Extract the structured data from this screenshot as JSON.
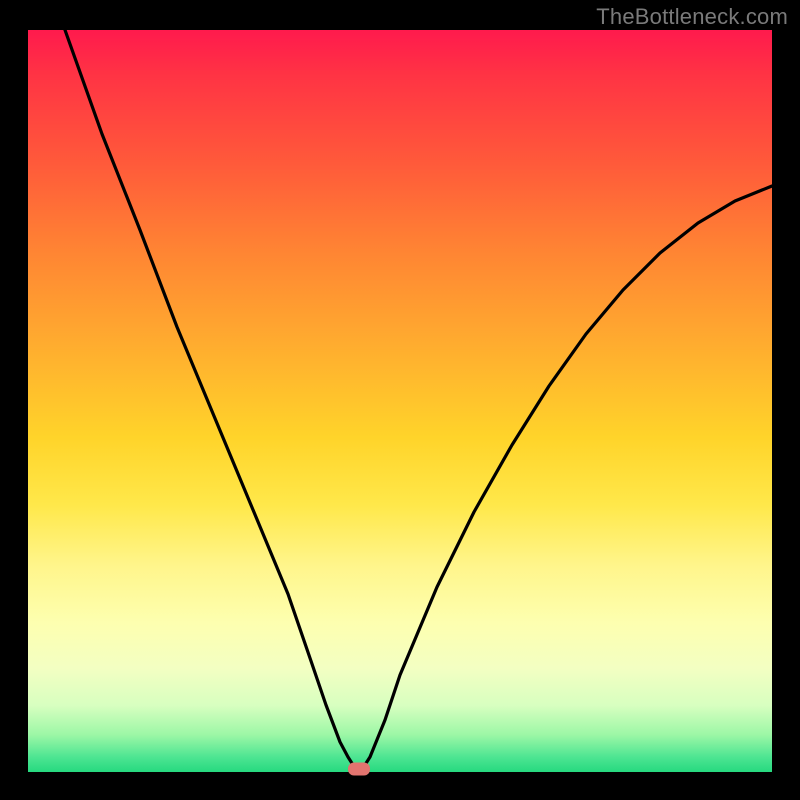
{
  "watermark": "TheBottleneck.com",
  "chart_data": {
    "type": "line",
    "title": "",
    "xlabel": "",
    "ylabel": "",
    "xlim": [
      0,
      100
    ],
    "ylim": [
      0,
      100
    ],
    "grid": false,
    "series": [
      {
        "name": "bottleneck-curve",
        "x": [
          5,
          10,
          15,
          20,
          25,
          30,
          35,
          38,
          40,
          42,
          43,
          44,
          45,
          46,
          48,
          50,
          55,
          60,
          65,
          70,
          75,
          80,
          85,
          90,
          95,
          100
        ],
        "y": [
          100,
          86,
          73,
          60,
          48,
          36,
          24,
          15,
          9,
          4,
          2,
          0.5,
          0.5,
          2,
          7,
          13,
          25,
          35,
          44,
          52,
          59,
          65,
          70,
          74,
          77,
          79
        ]
      }
    ],
    "minimum_marker": {
      "x": 44.5,
      "y": 0
    },
    "background": "red-yellow-green vertical gradient",
    "frame_color": "#000000"
  }
}
